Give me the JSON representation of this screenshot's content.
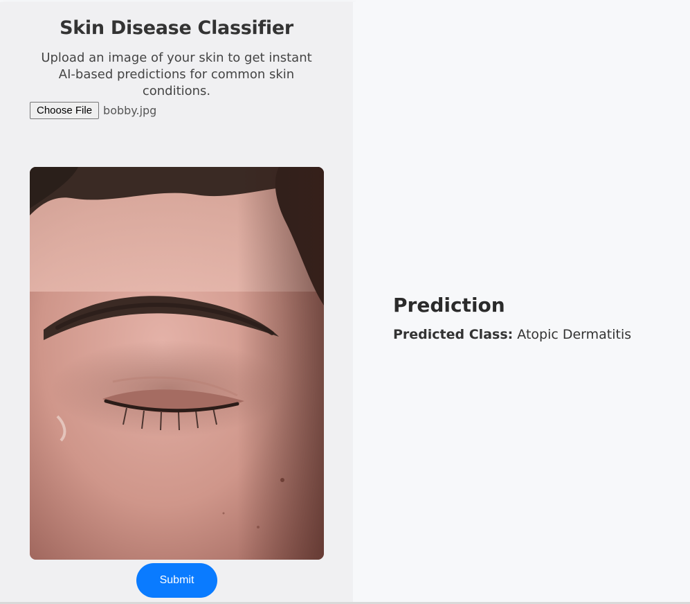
{
  "header": {
    "title": "Skin Disease Classifier",
    "subtitle": "Upload an image of your skin to get instant AI-based predictions for common skin conditions."
  },
  "upload": {
    "choose_file_label": "Choose File",
    "file_name": "bobby.jpg"
  },
  "preview": {
    "image_description_icon": "skin-photo-closed-eye"
  },
  "actions": {
    "submit_label": "Submit"
  },
  "prediction": {
    "heading": "Prediction",
    "label": "Predicted Class:",
    "value": "Atopic Dermatitis"
  },
  "colors": {
    "left_panel_bg": "#f0f0f2",
    "right_panel_bg": "#f7f8fa",
    "submit_bg": "#0a7bff",
    "text": "#333333"
  }
}
